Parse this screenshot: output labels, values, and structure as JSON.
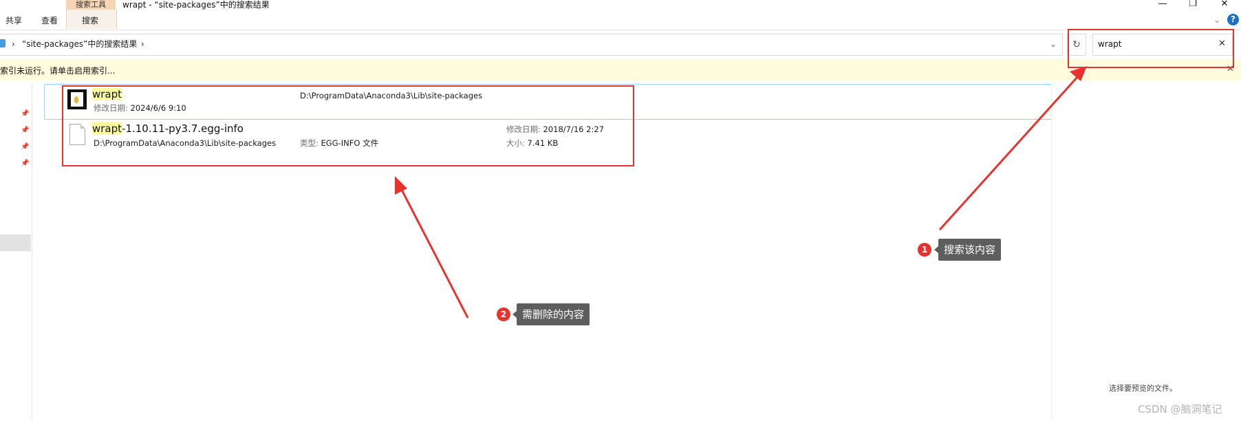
{
  "window": {
    "title": "wrapt - “site-packages”中的搜索结果",
    "controls": {
      "minimize": "—",
      "restore": "❐",
      "close": "✕"
    }
  },
  "ribbon": {
    "context_tab": "搜索工具",
    "tabs": [
      "共享",
      "查看",
      "搜索"
    ],
    "expand_icon": "chevron-down-icon",
    "help_glyph": "?"
  },
  "address_bar": {
    "back_chevron": "›",
    "crumb": "“site-packages”中的搜索结果",
    "crumb_chevron": "›",
    "dropdown": "⌄",
    "refresh_glyph": "↻"
  },
  "search": {
    "value": "wrapt",
    "clear_glyph": "✕"
  },
  "info_bar": {
    "text": "索引未运行。请单击启用索引...",
    "close_glyph": "✕"
  },
  "results": [
    {
      "name_highlight": "wrapt",
      "name_rest": "",
      "location": "D:\\ProgramData\\Anaconda3\\Lib\\site-packages",
      "modified_label": "修改日期:",
      "modified": "2024/6/6 9:10",
      "icon": "python-folder-icon"
    },
    {
      "name_highlight": "wrapt",
      "name_rest": "-1.10.11-py3.7.egg-info",
      "location": "D:\\ProgramData\\Anaconda3\\Lib\\site-packages",
      "type_label": "类型:",
      "type": "EGG-INFO 文件",
      "modified_label": "修改日期:",
      "modified": "2018/7/16 2:27",
      "size_label": "大小:",
      "size": "7.41 KB",
      "icon": "file-icon"
    }
  ],
  "preview": {
    "message": "选择要预览的文件。"
  },
  "annotations": {
    "callout1": {
      "number": "1",
      "text": "搜索该内容"
    },
    "callout2": {
      "number": "2",
      "text": "需删除的内容"
    },
    "color": "#e8322f"
  },
  "watermark": "CSDN @脑洞笔记"
}
